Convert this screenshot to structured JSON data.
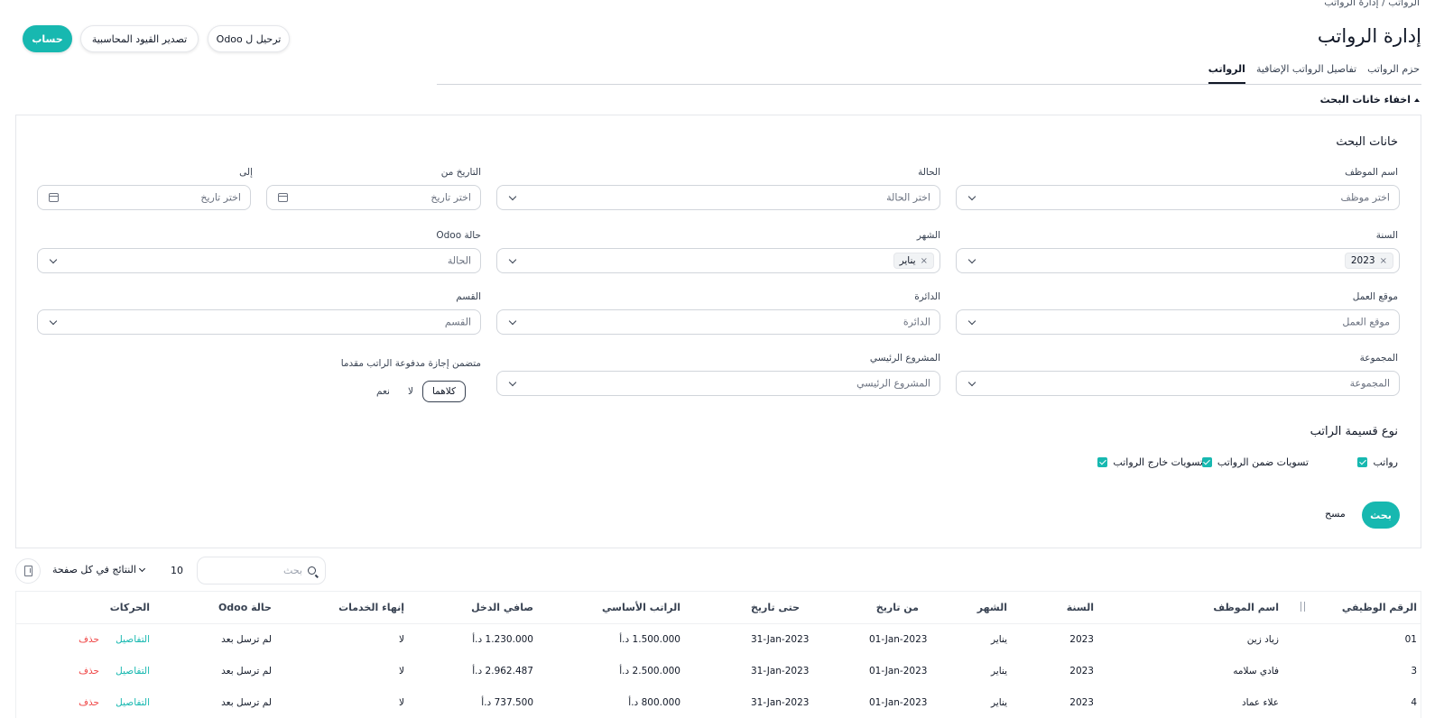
{
  "breadcrumb": "الرواتب / إدارة الرواتب",
  "page_title": "إدارة الرواتب",
  "actions": {
    "calculate": "حساب",
    "export_entries": "تصدير القيود المحاسبية",
    "post_to_odoo": "ترحيل ل Odoo"
  },
  "tabs": [
    {
      "label": "الرواتب",
      "active": true
    },
    {
      "label": "تفاصيل الرواتب الإضافية",
      "active": false
    },
    {
      "label": "حزم الرواتب",
      "active": false
    }
  ],
  "toggle_search": "اخفاء خانات البحث",
  "search": {
    "title": "خانات البحث",
    "employee_label": "اسم الموظف",
    "employee_placeholder": "اختر موظف",
    "status_label": "الحالة",
    "status_placeholder": "اختر الحالة",
    "date_from_label": "التاريخ من",
    "date_from_placeholder": "اختر تاريخ",
    "date_to_label": "إلى",
    "date_to_placeholder": "اختر تاريخ",
    "year_label": "السنة",
    "year_value": "2023",
    "month_label": "الشهر",
    "month_value": "يناير",
    "odoo_status_label": "حالة Odoo",
    "odoo_status_placeholder": "الحالة",
    "work_location_label": "موقع العمل",
    "work_location_placeholder": "موقع العمل",
    "department_label": "الدائرة",
    "department_placeholder": "الدائرة",
    "section_label": "القسم",
    "section_placeholder": "القسم",
    "group_label": "المجموعة",
    "group_placeholder": "المجموعة",
    "main_project_label": "المشروع الرئيسي",
    "main_project_placeholder": "المشروع الرئيسي",
    "prepaid_leave_label": "متضمن إجازة مدفوعة الراتب مقدما",
    "prepaid_options": [
      "نعم",
      "لا",
      "كلاهما"
    ],
    "prepaid_selected": "كلاهما",
    "slip_type_title": "نوع قسيمة الراتب",
    "slip_types": [
      {
        "label": "رواتب",
        "checked": true
      },
      {
        "label": "تسويات ضمن الرواتب",
        "checked": true
      },
      {
        "label": "تسويات خارج الرواتب",
        "checked": true
      }
    ],
    "search_button": "بحث",
    "clear_button": "مسح"
  },
  "table_controls": {
    "search_placeholder": "بحث",
    "page_size": "10",
    "per_page_label": "النتائج في كل صفحة"
  },
  "table": {
    "columns": [
      "الرقم الوظيفي",
      "اسم الموظف",
      "السنة",
      "الشهر",
      "من تاريخ",
      "حتى تاريخ",
      "الراتب الأساسي",
      "صافي الدخل",
      "إنهاء الخدمات",
      "حالة Odoo",
      "الحركات"
    ],
    "rows": [
      {
        "id": "01",
        "name": "زياد زين",
        "year": "2023",
        "month": "يناير",
        "from": "01-Jan-2023",
        "to": "31-Jan-2023",
        "basic": "1.500.000 د.أ",
        "net": "1.230.000 د.أ",
        "termination": "لا",
        "odoo": "لم ترسل بعد",
        "details": "التفاصيل",
        "delete": "حذف"
      },
      {
        "id": "3",
        "name": "فادي سلامه",
        "year": "2023",
        "month": "يناير",
        "from": "01-Jan-2023",
        "to": "31-Jan-2023",
        "basic": "2.500.000 د.أ",
        "net": "2.962.487 د.أ",
        "termination": "لا",
        "odoo": "لم ترسل بعد",
        "details": "التفاصيل",
        "delete": "حذف"
      },
      {
        "id": "4",
        "name": "علاء عماد",
        "year": "2023",
        "month": "يناير",
        "from": "01-Jan-2023",
        "to": "31-Jan-2023",
        "basic": "800.000 د.أ",
        "net": "737.500 د.أ",
        "termination": "لا",
        "odoo": "لم ترسل بعد",
        "details": "التفاصيل",
        "delete": "حذف"
      }
    ]
  },
  "colors": {
    "accent": "#17b8b0",
    "danger": "#ef4444"
  }
}
